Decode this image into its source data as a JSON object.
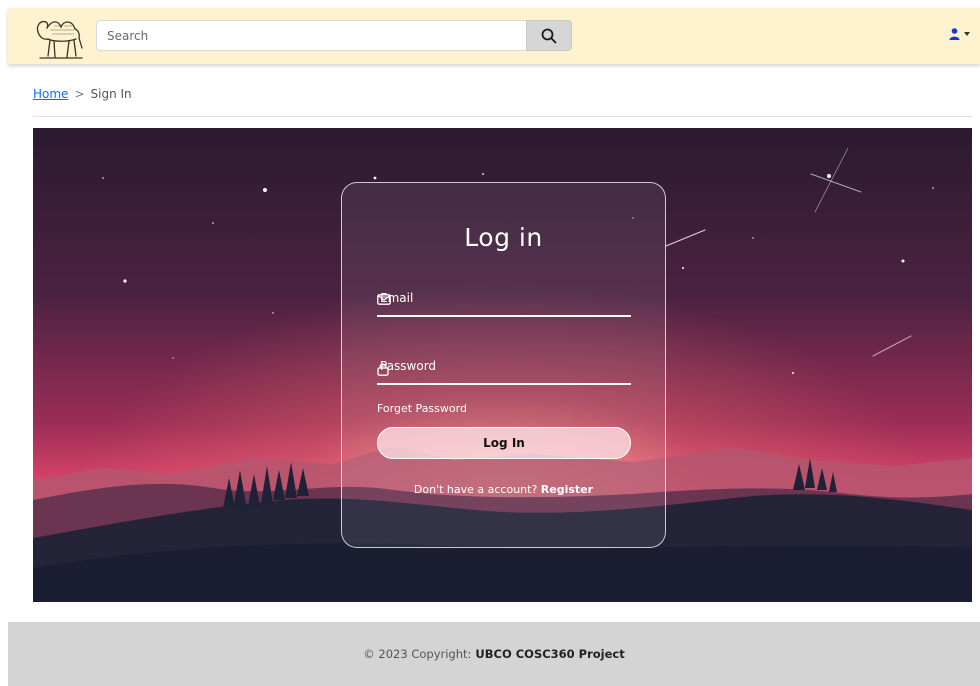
{
  "header": {
    "search_placeholder": "Search",
    "search_icon": "search-icon",
    "user_icon": "user-icon",
    "accent": "#0d3bd9"
  },
  "breadcrumb": {
    "home": "Home",
    "separator": ">",
    "current": "Sign In"
  },
  "login": {
    "title": "Log in",
    "email_label": "Email",
    "email_icon": "mail-icon",
    "password_label": "Password",
    "password_icon": "lock-icon",
    "forget_password": "Forget Password",
    "login_button": "Log In",
    "no_account_text": "Don't have a account?",
    "register_link": "Register"
  },
  "footer": {
    "copyright": "© 2023 Copyright:",
    "project": "UBCO COSC360 Project"
  }
}
